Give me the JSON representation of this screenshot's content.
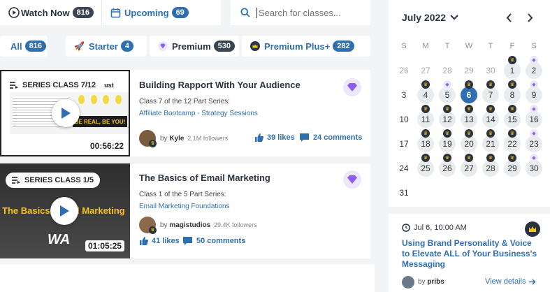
{
  "tabs": {
    "watch_now": {
      "label": "Watch Now",
      "count": "816"
    },
    "upcoming": {
      "label": "Upcoming",
      "count": "69"
    }
  },
  "search": {
    "placeholder": "Search for classes..."
  },
  "filters": [
    {
      "label": "All",
      "count": "816"
    },
    {
      "label": "Starter",
      "count": "4"
    },
    {
      "label": "Premium",
      "count": "530"
    },
    {
      "label": "Premium Plus+",
      "count": "282"
    }
  ],
  "classes": [
    {
      "thumb_badge": "SERIES CLASS 7/12",
      "thumb_corner_text": "ust",
      "thumb_caption": "BE REAL, BE YOU!",
      "duration": "00:56:22",
      "title": "Building Rapport With Your Audience",
      "subtitle": "Class 7 of the 12 Part Series:",
      "series_link": "Affiliate Bootcamp - Strategy Sessions",
      "author_prefix": "by",
      "author": "Kyle",
      "followers": "2.1M followers",
      "likes": "39 likes",
      "comments": "24 comments"
    },
    {
      "thumb_badge": "SERIES CLASS 1/5",
      "thumb_caption_left": "The Basics o",
      "thumb_caption_right": "l Marketing",
      "thumb_logo": "WA",
      "duration": "01:05:25",
      "title": "The Basics of Email Marketing",
      "subtitle": "Class 1 of the 5 Part Series:",
      "series_link": "Email Marketing Foundations",
      "author_prefix": "by",
      "author": "magistudios",
      "followers": "29.4K followers",
      "likes": "41 likes",
      "comments": "50 comments"
    }
  ],
  "calendar": {
    "month_label": "July 2022",
    "weekdays": [
      "S",
      "M",
      "T",
      "W",
      "T",
      "F",
      "S"
    ],
    "weeks": [
      [
        {
          "d": "26",
          "muted": true
        },
        {
          "d": "27",
          "muted": true
        },
        {
          "d": "28",
          "muted": true
        },
        {
          "d": "29",
          "muted": true
        },
        {
          "d": "30",
          "muted": true
        },
        {
          "d": "1",
          "mark": "crown"
        },
        {
          "d": "2",
          "mark": "gem"
        }
      ],
      [
        {
          "d": "3"
        },
        {
          "d": "4",
          "mark": "crown"
        },
        {
          "d": "5",
          "mark": "gem"
        },
        {
          "d": "6",
          "mark": "crown",
          "selected": true
        },
        {
          "d": "7",
          "mark": "crown"
        },
        {
          "d": "8",
          "mark": "crown"
        },
        {
          "d": "9",
          "mark": "gem"
        }
      ],
      [
        {
          "d": "10"
        },
        {
          "d": "11",
          "mark": "crown"
        },
        {
          "d": "12",
          "mark": "crown"
        },
        {
          "d": "13",
          "mark": "crown"
        },
        {
          "d": "14",
          "mark": "crown"
        },
        {
          "d": "15",
          "mark": "crown"
        },
        {
          "d": "16",
          "mark": "gem"
        }
      ],
      [
        {
          "d": "17"
        },
        {
          "d": "18",
          "mark": "crown"
        },
        {
          "d": "19",
          "mark": "crown"
        },
        {
          "d": "20",
          "mark": "crown"
        },
        {
          "d": "21",
          "mark": "crown"
        },
        {
          "d": "22",
          "mark": "crown"
        },
        {
          "d": "23",
          "mark": "gem"
        }
      ],
      [
        {
          "d": "24"
        },
        {
          "d": "25",
          "mark": "crown"
        },
        {
          "d": "26",
          "mark": "crown"
        },
        {
          "d": "27",
          "mark": "crown"
        },
        {
          "d": "28",
          "mark": "crown"
        },
        {
          "d": "29",
          "mark": "crown"
        },
        {
          "d": "30",
          "mark": "gem"
        }
      ],
      [
        {
          "d": "31"
        }
      ]
    ]
  },
  "event": {
    "time": "Jul 6, 10:00 AM",
    "title": "Using Brand Personality & Voice to Elevate ALL of Your Business's Messaging",
    "author": "pribs",
    "author_prefix": "by",
    "view_details": "View details"
  },
  "colors": {
    "accent": "#2f6fb1",
    "crown": "#f5c518",
    "gem": "#8b5cf6",
    "dark": "#2b3340"
  }
}
